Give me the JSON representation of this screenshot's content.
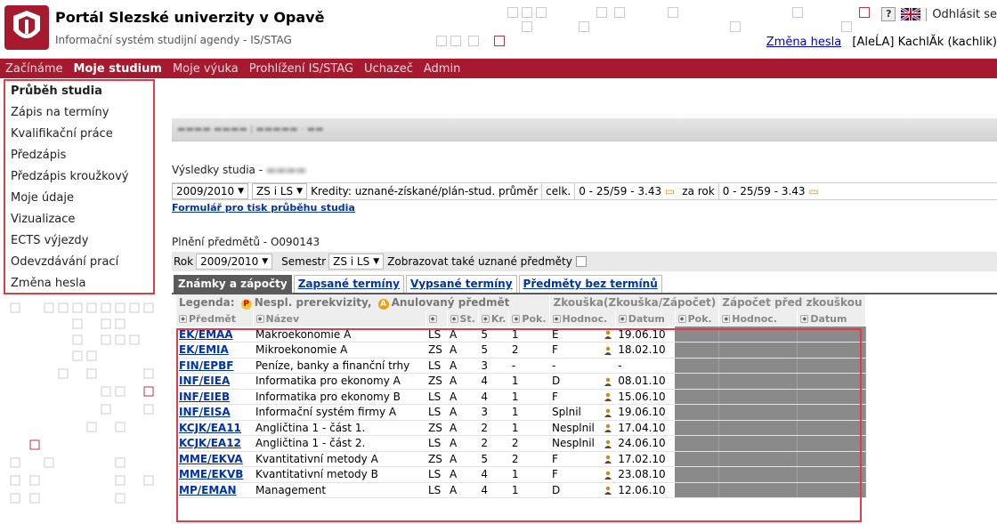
{
  "header": {
    "title": "Portál Slezské univerzity v Opavě",
    "subtitle": "Informační systém studijní agendy - IS/STAG",
    "help_label": "?",
    "logout_label": "Odhlásit se",
    "change_password_label": "Změna hesla",
    "user_role": "[AleĹA]",
    "user_name": "KachlĂk (kachlik)"
  },
  "nav": {
    "items": [
      "Začínáme",
      "Moje studium",
      "Moje výuka",
      "Prohlížení IS/STAG",
      "Uchazeč",
      "Admin"
    ],
    "active": "Moje studium"
  },
  "sidebar": {
    "items": [
      "Průběh studia",
      "Zápis na termíny",
      "Kvalifikační práce",
      "Předzápis",
      "Předzápis kroužkový",
      "Moje údaje",
      "Vizualizace",
      "ECTS výjezdy",
      "Odevzdávání prací",
      "Změna hesla"
    ],
    "active": "Průběh studia"
  },
  "results": {
    "title_prefix": "Výsledky studia -",
    "year": "2009/2010",
    "semester": "ZS i LS",
    "credits_label": "Kredity: uznané-získané/plán-stud. průměr",
    "total_label": "celk.",
    "total_value": "0 - 25/59 - 3.43",
    "year_label": "za rok",
    "year_value": "0 - 25/59 - 3.43",
    "print_link": "Formulář pro tisk průběhu studia"
  },
  "fulfilment": {
    "title": "Plnění předmětů - O090143",
    "rok_label": "Rok",
    "rok_value": "2009/2010",
    "semestr_label": "Semestr",
    "semestr_value": "ZS i LS",
    "show_label": "Zobrazovat také uznané předměty"
  },
  "tabs": [
    "Známky a zápočty",
    "Zapsané termíny",
    "Vypsané termíny",
    "Předměty bez termínů"
  ],
  "legend": {
    "label": "Legenda:",
    "item1": "Nespl. prerekvizity,",
    "item2": "Anulovaný předmět",
    "badge1": "P",
    "badge2": "A",
    "group_exam": "Zkouška(Zkouška/Zápočet)",
    "group_credit": "Zápočet před zkouškou"
  },
  "columns": [
    "Předmět",
    "Název",
    "",
    "St.",
    "Kr.",
    "Pok.",
    "Hodnoc.",
    "Datum",
    "Pok.",
    "Hodnoc.",
    "Datum"
  ],
  "rows": [
    {
      "code": "EK/EMAA",
      "name": "Makroekonomie A",
      "sem": "LS",
      "st": "A",
      "kr": "5",
      "pok": "1",
      "hod": "E",
      "icon": true,
      "date": "19.06.10"
    },
    {
      "code": "EK/EMIA",
      "name": "Mikroekonomie A",
      "sem": "ZS",
      "st": "A",
      "kr": "5",
      "pok": "2",
      "hod": "F",
      "icon": true,
      "date": "18.02.10"
    },
    {
      "code": "FIN/EPBF",
      "name": "Peníze, banky a finanční trhy",
      "sem": "LS",
      "st": "A",
      "kr": "3",
      "pok": "-",
      "hod": "-",
      "icon": false,
      "date": "-"
    },
    {
      "code": "INF/EIEA",
      "name": "Informatika pro ekonomy A",
      "sem": "ZS",
      "st": "A",
      "kr": "4",
      "pok": "1",
      "hod": "D",
      "icon": true,
      "date": "08.01.10"
    },
    {
      "code": "INF/EIEB",
      "name": "Informatika pro ekonomy B",
      "sem": "LS",
      "st": "A",
      "kr": "4",
      "pok": "1",
      "hod": "F",
      "icon": true,
      "date": "15.06.10"
    },
    {
      "code": "INF/EISA",
      "name": "Informační systém firmy A",
      "sem": "LS",
      "st": "A",
      "kr": "3",
      "pok": "1",
      "hod": "Splnil",
      "icon": true,
      "date": "19.06.10"
    },
    {
      "code": "KCJK/EA11",
      "name": "Angličtina 1 - část 1.",
      "sem": "ZS",
      "st": "A",
      "kr": "2",
      "pok": "1",
      "hod": "Nesplnil",
      "icon": true,
      "date": "17.04.10"
    },
    {
      "code": "KCJK/EA12",
      "name": "Angličtina 1 - část 2.",
      "sem": "LS",
      "st": "A",
      "kr": "2",
      "pok": "2",
      "hod": "Nesplnil",
      "icon": true,
      "date": "24.06.10"
    },
    {
      "code": "MME/EKVA",
      "name": "Kvantitativní metody A",
      "sem": "ZS",
      "st": "A",
      "kr": "5",
      "pok": "2",
      "hod": "F",
      "icon": true,
      "date": "17.02.10"
    },
    {
      "code": "MME/EKVB",
      "name": "Kvantitativní metody B",
      "sem": "LS",
      "st": "A",
      "kr": "4",
      "pok": "1",
      "hod": "F",
      "icon": true,
      "date": "23.08.10"
    },
    {
      "code": "MP/EMAN",
      "name": "Management",
      "sem": "LS",
      "st": "A",
      "kr": "4",
      "pok": "1",
      "hod": "D",
      "icon": true,
      "date": "12.06.10"
    }
  ]
}
